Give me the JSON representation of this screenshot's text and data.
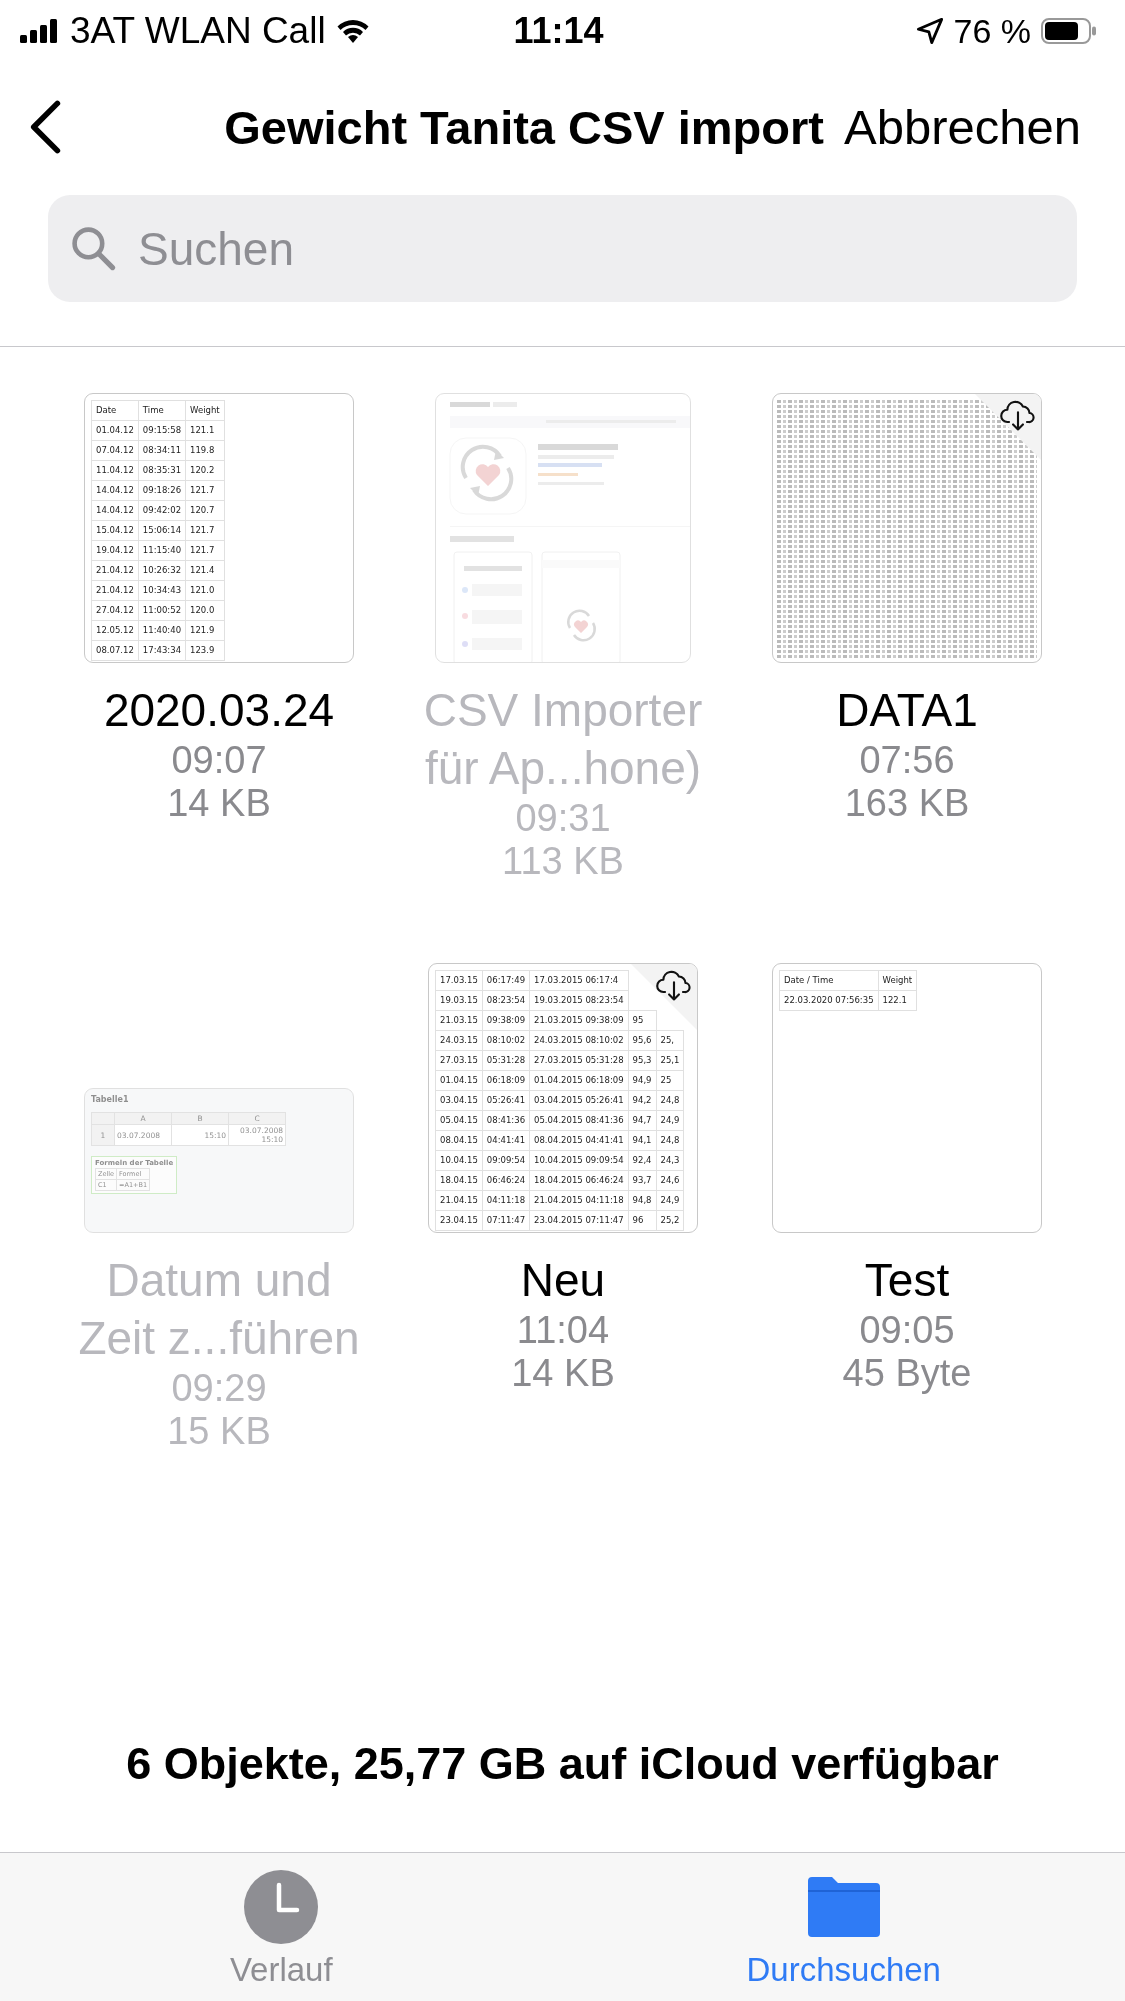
{
  "status_bar": {
    "carrier": "3AT WLAN Call",
    "time": "11:14",
    "battery": "76 %"
  },
  "nav": {
    "title": "Gewicht Tanita CSV import",
    "cancel": "Abbrechen"
  },
  "search": {
    "placeholder": "Suchen"
  },
  "files": [
    {
      "name_lines": [
        "2020.03.24"
      ],
      "time": "09:07",
      "size": "14 KB",
      "disabled": false,
      "cloud": false,
      "preview": {
        "kind": "table",
        "header": [
          "Date",
          "Time",
          "Weight"
        ],
        "rows": [
          [
            "01.04.12",
            "09:15:58",
            "121.1"
          ],
          [
            "07.04.12",
            "08:34:11",
            "119.8"
          ],
          [
            "11.04.12",
            "08:35:31",
            "120.2"
          ],
          [
            "14.04.12",
            "09:18:26",
            "121.7"
          ],
          [
            "14.04.12",
            "09:42:02",
            "120.7"
          ],
          [
            "15.04.12",
            "15:06:14",
            "121.7"
          ],
          [
            "19.04.12",
            "11:15:40",
            "121.7"
          ],
          [
            "21.04.12",
            "10:26:32",
            "121.4"
          ],
          [
            "21.04.12",
            "10:34:43",
            "121.0"
          ],
          [
            "27.04.12",
            "11:00:52",
            "120.0"
          ],
          [
            "12.05.12",
            "11:40:40",
            "121.9"
          ],
          [
            "08.07.12",
            "17:43:34",
            "123.9"
          ]
        ]
      }
    },
    {
      "name_lines": [
        "CSV Importer",
        "für Ap...hone)"
      ],
      "time": "09:31",
      "size": "113 KB",
      "disabled": true,
      "cloud": false,
      "preview": {
        "kind": "webpage"
      }
    },
    {
      "name_lines": [
        "DATA1"
      ],
      "time": "07:56",
      "size": "163 KB",
      "disabled": false,
      "cloud": true,
      "preview": {
        "kind": "dense"
      }
    },
    {
      "name_lines": [
        "Datum und",
        "Zeit z...führen"
      ],
      "time": "09:29",
      "size": "15 KB",
      "disabled": true,
      "cloud": false,
      "preview": {
        "kind": "sheet",
        "sheet": "Tabelle1",
        "columns": [
          "A",
          "B",
          "C"
        ],
        "rows": [
          {
            "index": "1",
            "cells": [
              "03.07.2008",
              "15:10",
              "03.07.2008 15:10"
            ]
          }
        ],
        "formulas_title": "Formeln der Tabelle",
        "formula_header": [
          "Zelle",
          "Formel"
        ],
        "formulas": [
          [
            "C1",
            "=A1+B1"
          ]
        ]
      }
    },
    {
      "name_lines": [
        "Neu"
      ],
      "time": "11:04",
      "size": "14 KB",
      "disabled": false,
      "cloud": true,
      "preview": {
        "kind": "table",
        "rows": [
          [
            "17.03.15",
            "06:17:49",
            "17.03.2015 06:17:4"
          ],
          [
            "19.03.15",
            "08:23:54",
            "19.03.2015 08:23:54"
          ],
          [
            "21.03.15",
            "09:38:09",
            "21.03.2015 09:38:09",
            "95"
          ],
          [
            "24.03.15",
            "08:10:02",
            "24.03.2015 08:10:02",
            "95,6",
            "25,"
          ],
          [
            "27.03.15",
            "05:31:28",
            "27.03.2015 05:31:28",
            "95,3",
            "25,1"
          ],
          [
            "01.04.15",
            "06:18:09",
            "01.04.2015 06:18:09",
            "94,9",
            "25"
          ],
          [
            "03.04.15",
            "05:26:41",
            "03.04.2015 05:26:41",
            "94,2",
            "24,8"
          ],
          [
            "05.04.15",
            "08:41:36",
            "05.04.2015 08:41:36",
            "94,7",
            "24,9"
          ],
          [
            "08.04.15",
            "04:41:41",
            "08.04.2015 04:41:41",
            "94,1",
            "24,8"
          ],
          [
            "10.04.15",
            "09:09:54",
            "10.04.2015 09:09:54",
            "92,4",
            "24,3"
          ],
          [
            "18.04.15",
            "06:46:24",
            "18.04.2015 06:46:24",
            "93,7",
            "24,6"
          ],
          [
            "21.04.15",
            "04:11:18",
            "21.04.2015 04:11:18",
            "94,8",
            "24,9"
          ],
          [
            "23.04.15",
            "07:11:47",
            "23.04.2015 07:11:47",
            "96",
            "25,2"
          ]
        ]
      }
    },
    {
      "name_lines": [
        "Test"
      ],
      "time": "09:05",
      "size": "45 Byte",
      "disabled": false,
      "cloud": false,
      "preview": {
        "kind": "table",
        "header": [
          "Date / Time",
          "Weight"
        ],
        "rows": [
          [
            "22.03.2020 07:56:35",
            "122.1"
          ]
        ]
      }
    }
  ],
  "footer": "6 Objekte, 25,77 GB auf iCloud verfügbar",
  "tabs": [
    {
      "label": "Verlauf",
      "selected": false
    },
    {
      "label": "Durchsuchen",
      "selected": true
    }
  ]
}
